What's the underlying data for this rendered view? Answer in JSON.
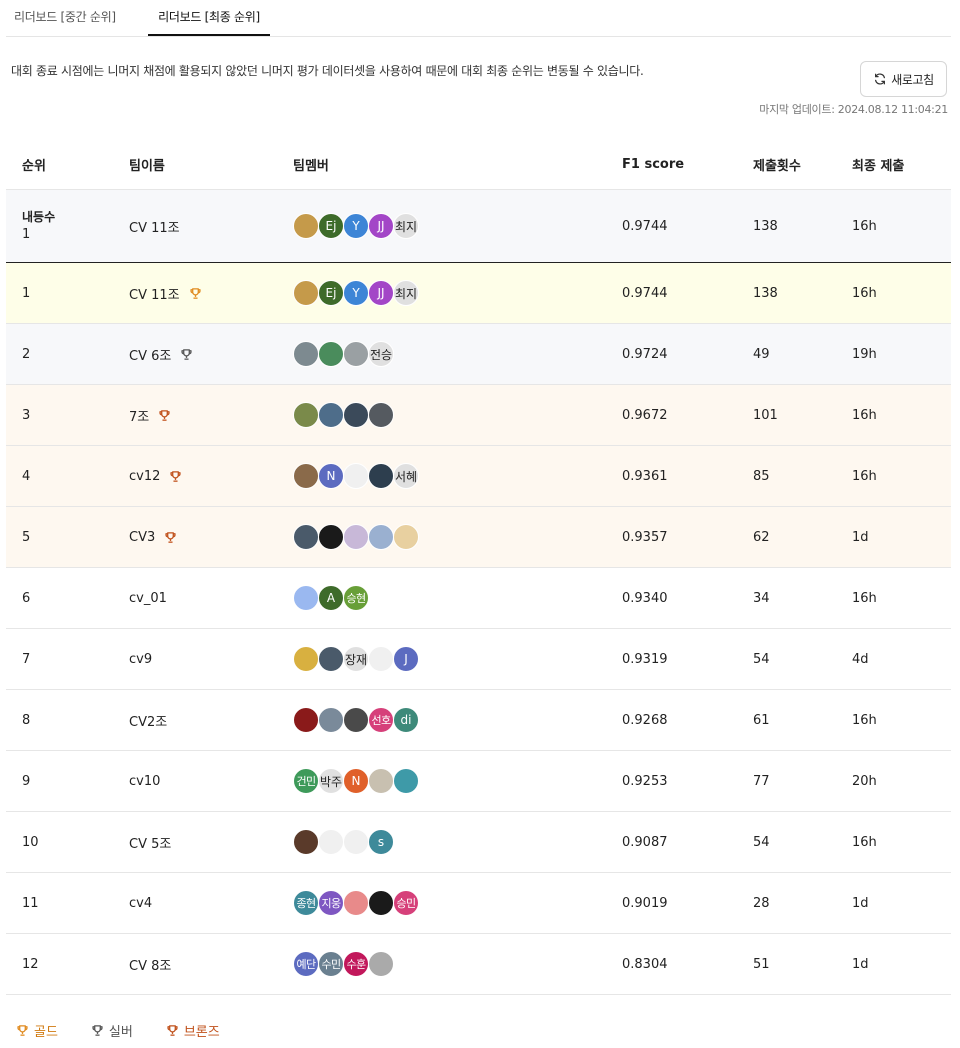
{
  "tabs": [
    {
      "label": "리더보드 [중간 순위]",
      "active": false
    },
    {
      "label": "리더보드 [최종 순위]",
      "active": true
    }
  ],
  "notice": "대회 종료 시점에는 니머지 채점에 활용되지 않았던 니머지 평가 데이터셋을 사용하여 때문에 대회 최종 순위는 변동될 수 있습니다.",
  "refresh_label": "새로고침",
  "updated": "마지막 업데이트: 2024.08.12 11:04:21",
  "columns": {
    "rank": "순위",
    "team": "팀이름",
    "members": "팀멤버",
    "f1": "F1 score",
    "subs": "제출횟수",
    "last": "최종 제출"
  },
  "my_row": {
    "rank_label": "내등수",
    "rank": "1",
    "team": "CV 11조",
    "f1": "0.9744",
    "subs": "138",
    "last": "16h",
    "members": [
      {
        "t": "",
        "c": "#c59a4a",
        "dark": false,
        "icon": "dog-photo"
      },
      {
        "t": "Ej",
        "c": "#3e6b2a",
        "dark": false
      },
      {
        "t": "Y",
        "c": "#3d85d6",
        "dark": false
      },
      {
        "t": "JJ",
        "c": "#a346c7",
        "dark": false
      },
      {
        "t": "최지",
        "c": "#e0e0e0",
        "dark": true
      }
    ]
  },
  "rows": [
    {
      "rank": "1",
      "team": "CV 11조",
      "medal": "gold",
      "f1": "0.9744",
      "subs": "138",
      "last": "16h",
      "members": [
        {
          "t": "",
          "c": "#c59a4a",
          "dark": false
        },
        {
          "t": "Ej",
          "c": "#3e6b2a",
          "dark": false
        },
        {
          "t": "Y",
          "c": "#3d85d6",
          "dark": false
        },
        {
          "t": "JJ",
          "c": "#a346c7",
          "dark": false
        },
        {
          "t": "최지",
          "c": "#e0e0e0",
          "dark": true
        }
      ]
    },
    {
      "rank": "2",
      "team": "CV 6조",
      "medal": "silver",
      "f1": "0.9724",
      "subs": "49",
      "last": "19h",
      "members": [
        {
          "t": "",
          "c": "#7d8a90",
          "dark": false
        },
        {
          "t": "",
          "c": "#4a8c5c",
          "dark": false
        },
        {
          "t": "",
          "c": "#9aa0a3",
          "dark": false
        },
        {
          "t": "전승",
          "c": "#e0e0e0",
          "dark": true
        }
      ]
    },
    {
      "rank": "3",
      "team": "7조",
      "medal": "bronze",
      "f1": "0.9672",
      "subs": "101",
      "last": "16h",
      "members": [
        {
          "t": "",
          "c": "#7a8a4a",
          "dark": false
        },
        {
          "t": "",
          "c": "#4e6d8a",
          "dark": false
        },
        {
          "t": "",
          "c": "#3b4a5a",
          "dark": false
        },
        {
          "t": "",
          "c": "#555a60",
          "dark": false
        }
      ]
    },
    {
      "rank": "4",
      "team": "cv12",
      "medal": "bronze",
      "f1": "0.9361",
      "subs": "85",
      "last": "16h",
      "members": [
        {
          "t": "",
          "c": "#8a6a4a",
          "dark": false
        },
        {
          "t": "N",
          "c": "#5c6bc0",
          "dark": false
        },
        {
          "t": "",
          "c": "#f0f0f0",
          "dark": false
        },
        {
          "t": "",
          "c": "#2d3e4e",
          "dark": false
        },
        {
          "t": "서혜",
          "c": "#e0e0e0",
          "dark": true
        }
      ]
    },
    {
      "rank": "5",
      "team": "CV3",
      "medal": "bronze",
      "f1": "0.9357",
      "subs": "62",
      "last": "1d",
      "members": [
        {
          "t": "",
          "c": "#4a5a6a",
          "dark": false
        },
        {
          "t": "",
          "c": "#1a1a1a",
          "dark": false
        },
        {
          "t": "",
          "c": "#c8b8d8",
          "dark": false
        },
        {
          "t": "",
          "c": "#9ab0d0",
          "dark": false
        },
        {
          "t": "",
          "c": "#e8d0a0",
          "dark": false
        }
      ]
    },
    {
      "rank": "6",
      "team": "cv_01",
      "medal": "",
      "f1": "0.9340",
      "subs": "34",
      "last": "16h",
      "members": [
        {
          "t": "",
          "c": "#9ab8f0",
          "dark": false
        },
        {
          "t": "A",
          "c": "#3e6b2a",
          "dark": false
        },
        {
          "t": "승현",
          "c": "#689f38",
          "dark": false,
          "small": true
        }
      ]
    },
    {
      "rank": "7",
      "team": "cv9",
      "medal": "",
      "f1": "0.9319",
      "subs": "54",
      "last": "4d",
      "members": [
        {
          "t": "",
          "c": "#d8b040",
          "dark": false
        },
        {
          "t": "",
          "c": "#4a5a6a",
          "dark": false
        },
        {
          "t": "장재",
          "c": "#e0e0e0",
          "dark": true
        },
        {
          "t": "",
          "c": "#f0f0f0",
          "dark": false
        },
        {
          "t": "J",
          "c": "#5c6bc0",
          "dark": false
        }
      ]
    },
    {
      "rank": "8",
      "team": "CV2조",
      "medal": "",
      "f1": "0.9268",
      "subs": "61",
      "last": "16h",
      "members": [
        {
          "t": "",
          "c": "#8a1a1a",
          "dark": false
        },
        {
          "t": "",
          "c": "#7a8a9a",
          "dark": false
        },
        {
          "t": "",
          "c": "#4a4a4a",
          "dark": false
        },
        {
          "t": "선호",
          "c": "#d6407a",
          "dark": false,
          "small": true
        },
        {
          "t": "di",
          "c": "#3e8a7a",
          "dark": false
        }
      ]
    },
    {
      "rank": "9",
      "team": "cv10",
      "medal": "",
      "f1": "0.9253",
      "subs": "77",
      "last": "20h",
      "members": [
        {
          "t": "건민",
          "c": "#3e9a5a",
          "dark": false,
          "small": true
        },
        {
          "t": "박주",
          "c": "#e0e0e0",
          "dark": true
        },
        {
          "t": "N",
          "c": "#e0602a",
          "dark": false
        },
        {
          "t": "",
          "c": "#c8c0b0",
          "dark": false
        },
        {
          "t": "",
          "c": "#3e9aa8",
          "dark": false
        }
      ]
    },
    {
      "rank": "10",
      "team": "CV 5조",
      "medal": "",
      "f1": "0.9087",
      "subs": "54",
      "last": "16h",
      "members": [
        {
          "t": "",
          "c": "#5a3a2a",
          "dark": false
        },
        {
          "t": "",
          "c": "#f0f0f0",
          "dark": false
        },
        {
          "t": "",
          "c": "#f0f0f0",
          "dark": false
        },
        {
          "t": "s",
          "c": "#3e8a9a",
          "dark": false
        }
      ]
    },
    {
      "rank": "11",
      "team": "cv4",
      "medal": "",
      "f1": "0.9019",
      "subs": "28",
      "last": "1d",
      "members": [
        {
          "t": "종현",
          "c": "#3e8a9a",
          "dark": false,
          "small": true
        },
        {
          "t": "지웅",
          "c": "#7e57c2",
          "dark": false,
          "small": true
        },
        {
          "t": "",
          "c": "#e88a8a",
          "dark": false
        },
        {
          "t": "",
          "c": "#1a1a1a",
          "dark": false
        },
        {
          "t": "승민",
          "c": "#d6407a",
          "dark": false,
          "small": true
        }
      ]
    },
    {
      "rank": "12",
      "team": "CV 8조",
      "medal": "",
      "f1": "0.8304",
      "subs": "51",
      "last": "1d",
      "members": [
        {
          "t": "예단",
          "c": "#5c6bc0",
          "dark": false,
          "small": true
        },
        {
          "t": "수민",
          "c": "#6a8090",
          "dark": false,
          "small": true
        },
        {
          "t": "수훈",
          "c": "#c2185b",
          "dark": false,
          "small": true
        },
        {
          "t": "",
          "c": "#aaaaaa",
          "dark": false
        }
      ]
    }
  ],
  "legend": [
    {
      "label": "골드",
      "medal": "gold"
    },
    {
      "label": "실버",
      "medal": "silver"
    },
    {
      "label": "브론즈",
      "medal": "bronze"
    }
  ],
  "colors": {
    "gold": "#e08a1e",
    "silver": "#555555",
    "bronze": "#c0501a",
    "gold_text": "#d07a10",
    "silver_text": "#555555",
    "bronze_text": "#c0501a"
  }
}
